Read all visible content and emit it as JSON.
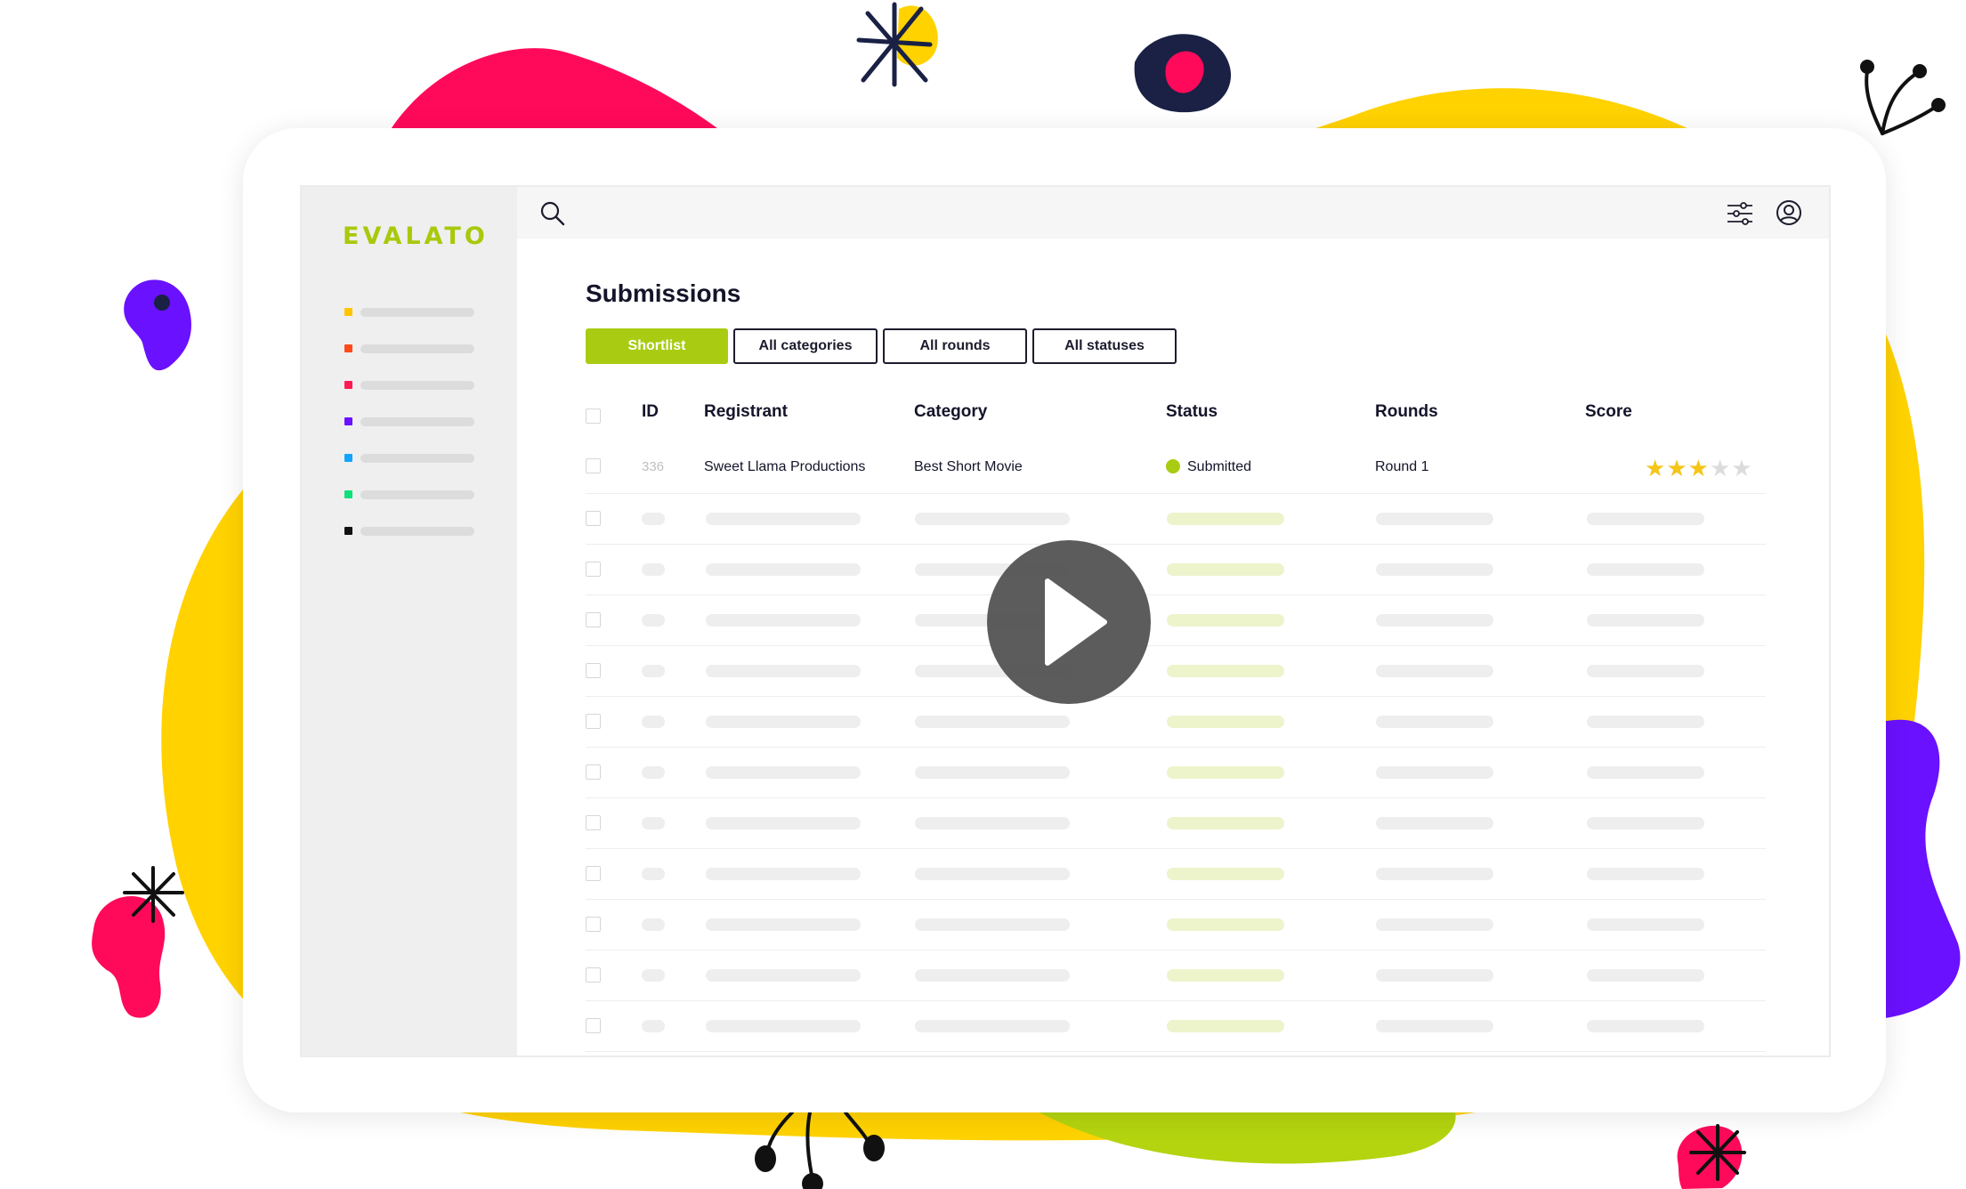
{
  "colors": {
    "accent": "#a9cc12",
    "yellow": "#ffd000",
    "pink": "#ff0a5a",
    "purple": "#6a11ff",
    "navy": "#1a2145",
    "lime": "#b3d40f"
  },
  "app": {
    "logo": "EVALATO"
  },
  "sidebar": {
    "items": [
      {
        "color": "#ffc400"
      },
      {
        "color": "#ff4a1a"
      },
      {
        "color": "#ff1a4f"
      },
      {
        "color": "#6a11ff"
      },
      {
        "color": "#14a3ff"
      },
      {
        "color": "#10e07a"
      },
      {
        "color": "#111111"
      }
    ]
  },
  "topbar": {
    "icons": [
      "search-icon",
      "filter-sliders-icon",
      "user-circle-icon"
    ]
  },
  "page": {
    "title": "Submissions"
  },
  "filters": {
    "shortlist": "Shortlist",
    "categories": "All categories",
    "rounds": "All rounds",
    "statuses": "All statuses"
  },
  "table": {
    "headers": {
      "id": "ID",
      "registrant": "Registrant",
      "category": "Category",
      "status": "Status",
      "rounds": "Rounds",
      "score": "Score"
    },
    "rows": [
      {
        "id": "336",
        "registrant": "Sweet Llama Productions",
        "category": "Best Short Movie",
        "status": "Submitted",
        "round": "Round 1",
        "score": 3,
        "score_max": 5
      }
    ],
    "placeholder_rows": 11
  },
  "video": {
    "icon": "play-icon"
  }
}
